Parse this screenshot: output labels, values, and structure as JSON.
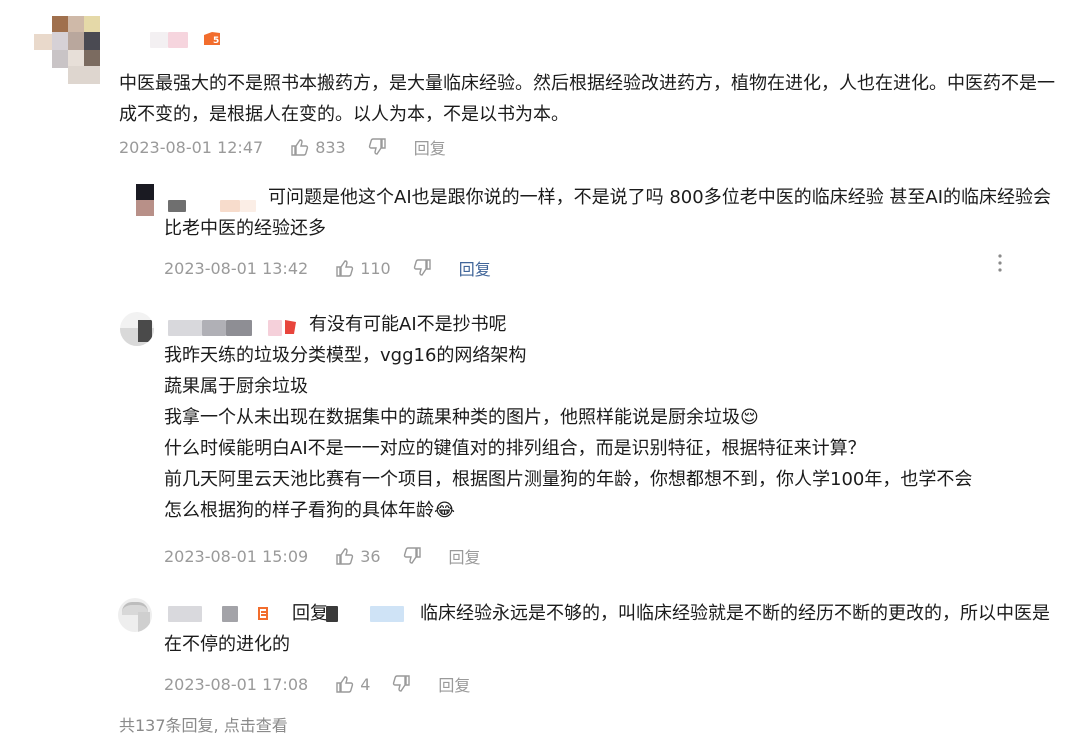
{
  "comment_main": {
    "text": "中医最强大的不是照书本搬药方，是大量临床经验。然后根据经验改进药方，植物在进化，人也在进化。中医药不是一成不变的，是根据人在变的。以人为本，不是以书为本。",
    "time": "2023-08-01 12:47",
    "likes": "833",
    "reply": "回复"
  },
  "replies": [
    {
      "text": "可问题是他这个AI也是跟你说的一样，不是说了吗 800多位老中医的临床经验 甚至AI的临床经验会比老中医的经验还多",
      "time": "2023-08-01 13:42",
      "likes": "110",
      "reply": "回复"
    },
    {
      "lines": [
        "有没有可能AI不是抄书呢",
        "我昨天练的垃圾分类模型，vgg16的网络架构",
        "蔬果属于厨余垃圾",
        "我拿一个从未出现在数据集中的蔬果种类的图片，他照样能说是厨余垃圾😌",
        "什么时候能明白AI不是一一对应的键值对的排列组合，而是识别特征，根据特征来计算？",
        "前几天阿里云天池比赛有一个项目，根据图片测量狗的年龄，你想都想不到，你人学100年，也学不会",
        "怎么根据狗的样子看狗的具体年龄😂"
      ],
      "time": "2023-08-01 15:09",
      "likes": "36",
      "reply": "回复"
    },
    {
      "reply_prefix": "回复",
      "text": "临床经验永远是不够的，叫临床经验就是不断的经历不断的更改的，所以中医是在不停的进化的",
      "time": "2023-08-01 17:08",
      "likes": "4",
      "reply": "回复"
    }
  ],
  "footer": {
    "summary": "共137条回复, 点击查看"
  },
  "colors": {
    "text": "#1b1b1b",
    "meta": "#9a9a9a",
    "link_blue": "#406599",
    "badge_orange": "#f26d2d",
    "badge_red": "#e8453c"
  },
  "icons": [
    "thumb-up-icon",
    "thumb-down-icon",
    "more-vertical-icon",
    "level-badge-icon",
    "flag-badge-icon"
  ]
}
